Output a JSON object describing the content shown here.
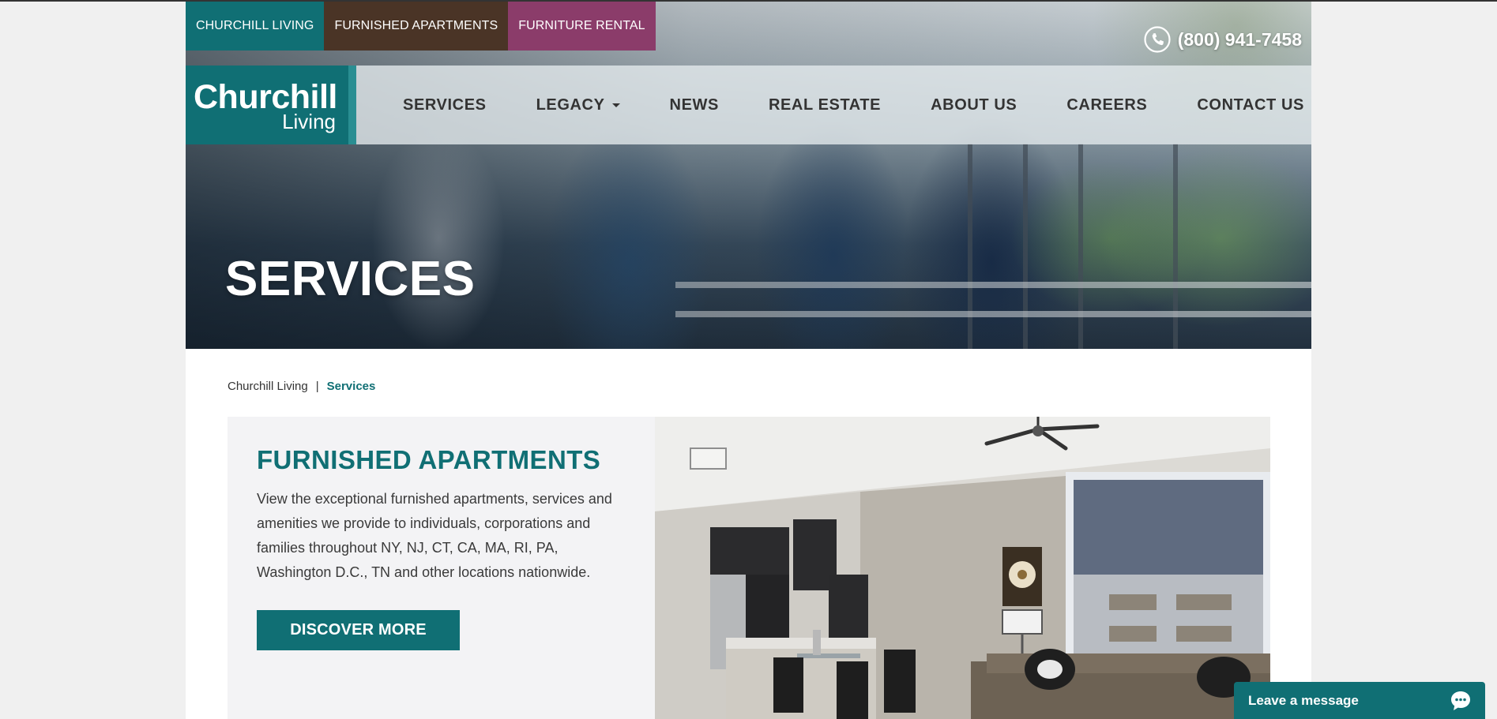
{
  "site_tabs": [
    "CHURCHILL LIVING",
    "FURNISHED APARTMENTS",
    "FURNITURE RENTAL"
  ],
  "phone": "(800) 941-7458",
  "logo": {
    "main": "Churchill",
    "sub": "Living"
  },
  "nav": [
    "SERVICES",
    "LEGACY",
    "NEWS",
    "REAL ESTATE",
    "ABOUT US",
    "CAREERS",
    "CONTACT US"
  ],
  "hero": {
    "title": "SERVICES"
  },
  "breadcrumb": {
    "home": "Churchill Living",
    "separator": "|",
    "current": "Services"
  },
  "feature": {
    "title": "FURNISHED APARTMENTS",
    "description": "View the exceptional furnished apartments, services and amenities we provide to individuals, corporations and families throughout NY, NJ, CT, CA, MA, RI, PA, Washington D.C., TN and other locations nationwide.",
    "button": "DISCOVER MORE"
  },
  "chat": {
    "label": "Leave a message"
  },
  "colors": {
    "teal": "#106f74",
    "brown": "#4a3426",
    "plum": "#8b3c6a",
    "page_bg": "#f0f0f0",
    "panel_bg": "#f3f3f5"
  },
  "icons": [
    "phone-icon",
    "chevron-down-icon",
    "chat-bubble-icon"
  ]
}
